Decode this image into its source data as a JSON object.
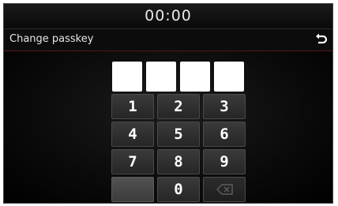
{
  "status": {
    "clock": "00:00"
  },
  "header": {
    "title": "Change passkey",
    "back_icon": "back-arrow-icon"
  },
  "passkey": {
    "length": 4,
    "entered": 0
  },
  "keypad": {
    "keys": [
      "1",
      "2",
      "3",
      "4",
      "5",
      "6",
      "7",
      "8",
      "9",
      "0"
    ],
    "backspace_icon": "backspace-icon",
    "backspace_enabled": false
  },
  "colors": {
    "background": "#000000",
    "key_face": "#2e2e2e",
    "title_divider": "#5a1616",
    "pin_box": "#ffffff"
  }
}
